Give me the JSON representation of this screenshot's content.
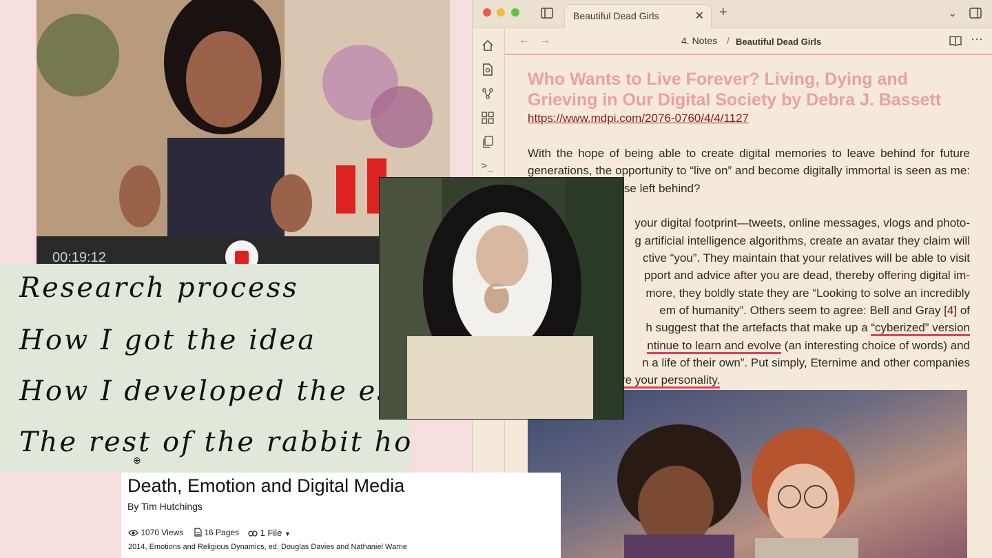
{
  "note_app": {
    "tab_title": "Beautiful Dead Girls",
    "breadcrumb_folder": "4. Notes",
    "breadcrumb_sep": "/",
    "breadcrumb_file": "Beautiful Dead Girls",
    "title": "Who Wants to Live Forever? Living, Dying and Grieving in Our Digital Society by Debra J. Bassett",
    "link": "https://www.mdpi.com/2076-0760/4/4/1127",
    "p1": "With the hope of being able to create digital memories to leave behind for future generations, the opportunity to “live on” and become digitally immortal is seen as",
    "p1_end": "me: but what about those left behind?",
    "p2_lines": [
      "your digital footprint—tweets, online messages, vlogs and photo-",
      "g artificial intelligence algorithms, create an avatar they claim will",
      "ctive “you”. They maintain that your relatives will be able to visit",
      "pport and advice after you are dead, thereby offering digital im-",
      "more, they boldly state they are “Looking to solve an incredibly",
      "em of humanity”. Others seem to agree: Bell and Gray [",
      "h suggest that the artefacts that make up a",
      "ntinue to learn and evolve",
      "n a life of their own”. Put simply, Eternime and other companies",
      "re your personality."
    ],
    "citation": "4",
    "after_citation": "] of",
    "hl_cyberized": " “cyberized” version",
    "after_evolve": " (an interesting choice of words) and"
  },
  "video": {
    "time": "00:19:12"
  },
  "handwritten_lines": [
    "Research process",
    "How I got the idea",
    "How I developed the essay",
    "The rest of the rabbit hole"
  ],
  "paper": {
    "title": "Death, Emotion and Digital Media",
    "author": "By Tim Hutchings",
    "views": "1070 Views",
    "pages": "16 Pages",
    "files": "1 File",
    "desc": "2014, Emotions and Religious Dynamics, ed. Douglas Davies and Nathaniel Warne"
  },
  "colors": {
    "background": "#f7dede",
    "note_bg": "#f5ead9",
    "title_pink": "#e8a0a6",
    "highlight_red": "#e0405a"
  }
}
